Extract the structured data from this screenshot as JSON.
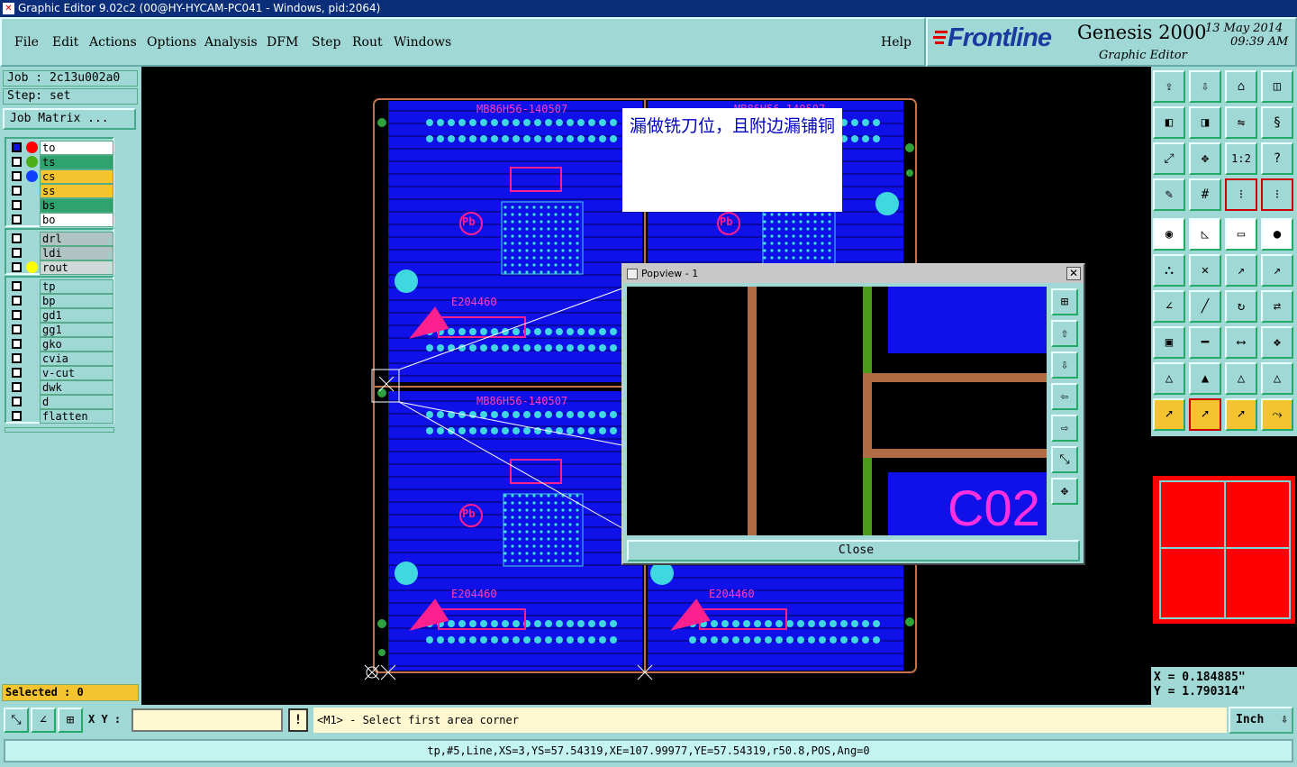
{
  "window": {
    "title": "Graphic Editor 9.02c2 (00@HY-HYCAM-PC041 - Windows, pid:2064)"
  },
  "menu": {
    "items": [
      "File",
      "Edit",
      "Actions",
      "Options",
      "Analysis",
      "DFM",
      "Step",
      "Rout",
      "Windows"
    ],
    "help": "Help"
  },
  "branding": {
    "logo": "Frontline",
    "product": "Genesis 2000",
    "subtitle": "Graphic Editor",
    "date": "13 May 2014",
    "time": "09:39 AM"
  },
  "job": {
    "job_label": "Job : 2c13u002a0",
    "step_label": "Step: set",
    "matrix_button": "Job Matrix ..."
  },
  "layers": {
    "group1": [
      {
        "name": "to",
        "dot": "#ff0000",
        "bg": "#ffffff"
      },
      {
        "name": "ts",
        "dot": "#4caf1a",
        "bg": "#2ea36e"
      },
      {
        "name": "cs",
        "dot": "#1040ff",
        "bg": "#f4c430"
      },
      {
        "name": "ss",
        "dot": "",
        "bg": "#f4c430"
      },
      {
        "name": "bs",
        "dot": "",
        "bg": "#2ea36e"
      },
      {
        "name": "bo",
        "dot": "",
        "bg": "#ffffff"
      }
    ],
    "group2": [
      {
        "name": "drl",
        "dot": "",
        "bg": "#b0c4c4"
      },
      {
        "name": "ldi",
        "dot": "",
        "bg": "#b0c4c4"
      },
      {
        "name": "rout",
        "dot": "#ffff00",
        "bg": "#d0d8d8"
      }
    ],
    "group3": [
      {
        "name": "tp"
      },
      {
        "name": "bp"
      },
      {
        "name": "gd1"
      },
      {
        "name": "gg1"
      },
      {
        "name": "gko"
      },
      {
        "name": "cvia"
      },
      {
        "name": "v-cut"
      },
      {
        "name": "dwk"
      },
      {
        "name": "d"
      },
      {
        "name": "flatten"
      }
    ]
  },
  "selected": "Selected : 0",
  "note_text": "漏做铣刀位，且附边漏铺铜",
  "pcb_labels": {
    "board_id": "MB86H56-140507",
    "chip_code": "E204460",
    "stamp": "Pb",
    "code2": "C02"
  },
  "popview": {
    "title": "Popview - 1",
    "close": "Close"
  },
  "coords": {
    "x": "X = 0.184885\"",
    "y": "Y = 1.790314\""
  },
  "status": {
    "xy_label": "X Y :",
    "xy_value": "",
    "prompt": "<M1> - Select first area corner",
    "units": "Inch"
  },
  "info_line": "tp,#5,Line,XS=3,YS=57.54319,XE=107.99977,YE=57.54319,r50.8,POS,Ang=0",
  "colors": {
    "accent_teal": "#9fd8d4",
    "pcb_blue": "#1010e8",
    "title_blue": "#0a2e7a"
  }
}
